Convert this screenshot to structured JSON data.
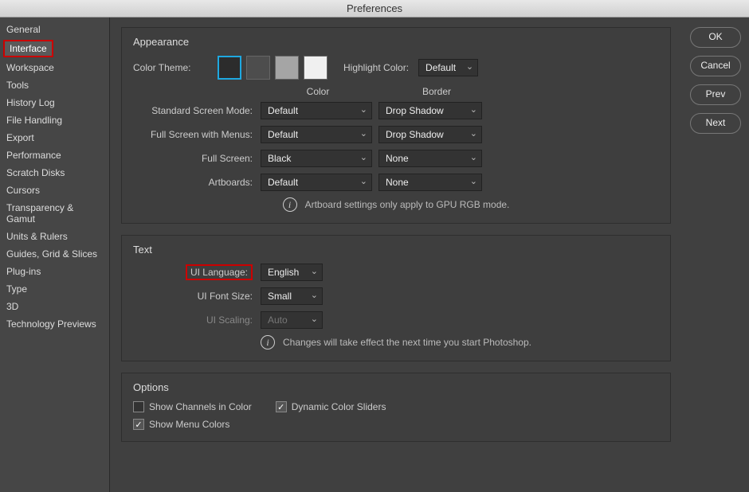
{
  "title": "Preferences",
  "sidebar": {
    "items": [
      {
        "label": "General"
      },
      {
        "label": "Interface",
        "active": true,
        "highlighted": true
      },
      {
        "label": "Workspace"
      },
      {
        "label": "Tools"
      },
      {
        "label": "History Log"
      },
      {
        "label": "File Handling"
      },
      {
        "label": "Export"
      },
      {
        "label": "Performance"
      },
      {
        "label": "Scratch Disks"
      },
      {
        "label": "Cursors"
      },
      {
        "label": "Transparency & Gamut"
      },
      {
        "label": "Units & Rulers"
      },
      {
        "label": "Guides, Grid & Slices"
      },
      {
        "label": "Plug-ins"
      },
      {
        "label": "Type"
      },
      {
        "label": "3D"
      },
      {
        "label": "Technology Previews"
      }
    ]
  },
  "buttons": {
    "ok": "OK",
    "cancel": "Cancel",
    "prev": "Prev",
    "next": "Next"
  },
  "appearance": {
    "title": "Appearance",
    "color_theme_label": "Color Theme:",
    "highlight_color_label": "Highlight Color:",
    "highlight_color_value": "Default",
    "color_header": "Color",
    "border_header": "Border",
    "rows": {
      "standard": {
        "label": "Standard Screen Mode:",
        "color": "Default",
        "border": "Drop Shadow"
      },
      "full_menus": {
        "label": "Full Screen with Menus:",
        "color": "Default",
        "border": "Drop Shadow"
      },
      "full": {
        "label": "Full Screen:",
        "color": "Black",
        "border": "None"
      },
      "artboards": {
        "label": "Artboards:",
        "color": "Default",
        "border": "None"
      }
    },
    "info": "Artboard settings only apply to GPU RGB mode."
  },
  "text": {
    "title": "Text",
    "ui_language_label": "UI Language:",
    "ui_language_value": "English",
    "ui_font_size_label": "UI Font Size:",
    "ui_font_size_value": "Small",
    "ui_scaling_label": "UI Scaling:",
    "ui_scaling_value": "Auto",
    "info": "Changes will take effect the next time you start Photoshop."
  },
  "options": {
    "title": "Options",
    "show_channels": "Show Channels in Color",
    "dynamic_sliders": "Dynamic Color Sliders",
    "show_menu_colors": "Show Menu Colors"
  }
}
